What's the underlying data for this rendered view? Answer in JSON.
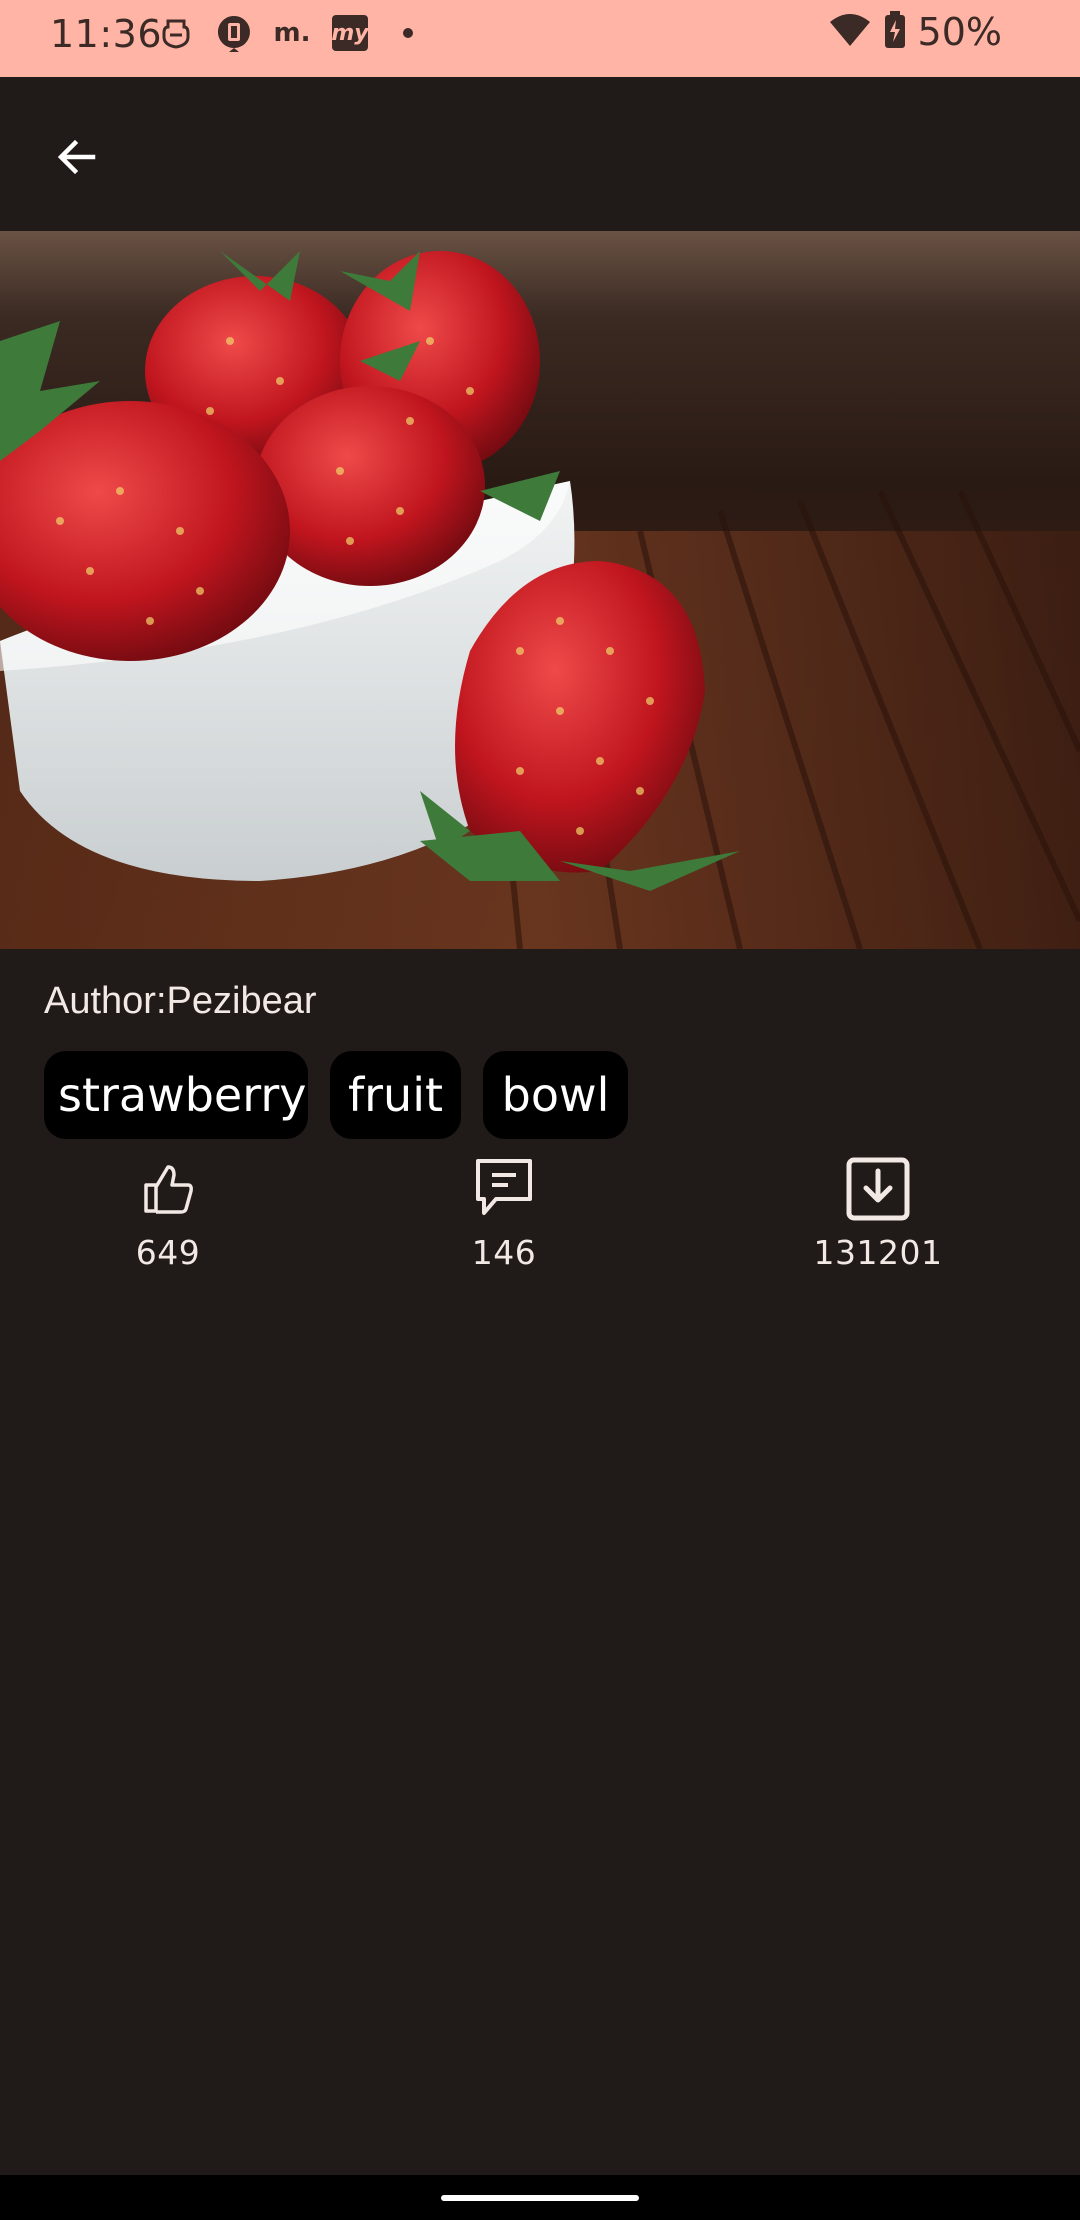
{
  "status_bar": {
    "time": "11:36",
    "notification_icons": [
      "mask-icon",
      "watch-icon",
      "m-icon",
      "my-app-icon",
      "dot-icon"
    ],
    "notification_m_text": "m.",
    "notification_my_text": "my",
    "battery": "50%",
    "background_color": "#ffb4a6"
  },
  "app_bar": {
    "back_icon": "arrow-back-icon"
  },
  "photo": {
    "subject": "strawberries-in-bowl-photo"
  },
  "author": {
    "label": "Author:",
    "name": "Pezibear"
  },
  "tags": [
    "strawberry",
    "fruit",
    "bowl"
  ],
  "stats": {
    "likes": "649",
    "comments": "146",
    "downloads": "131201"
  },
  "colors": {
    "background": "#201a18",
    "chip": "#000000",
    "text": "#f2e8e4"
  }
}
